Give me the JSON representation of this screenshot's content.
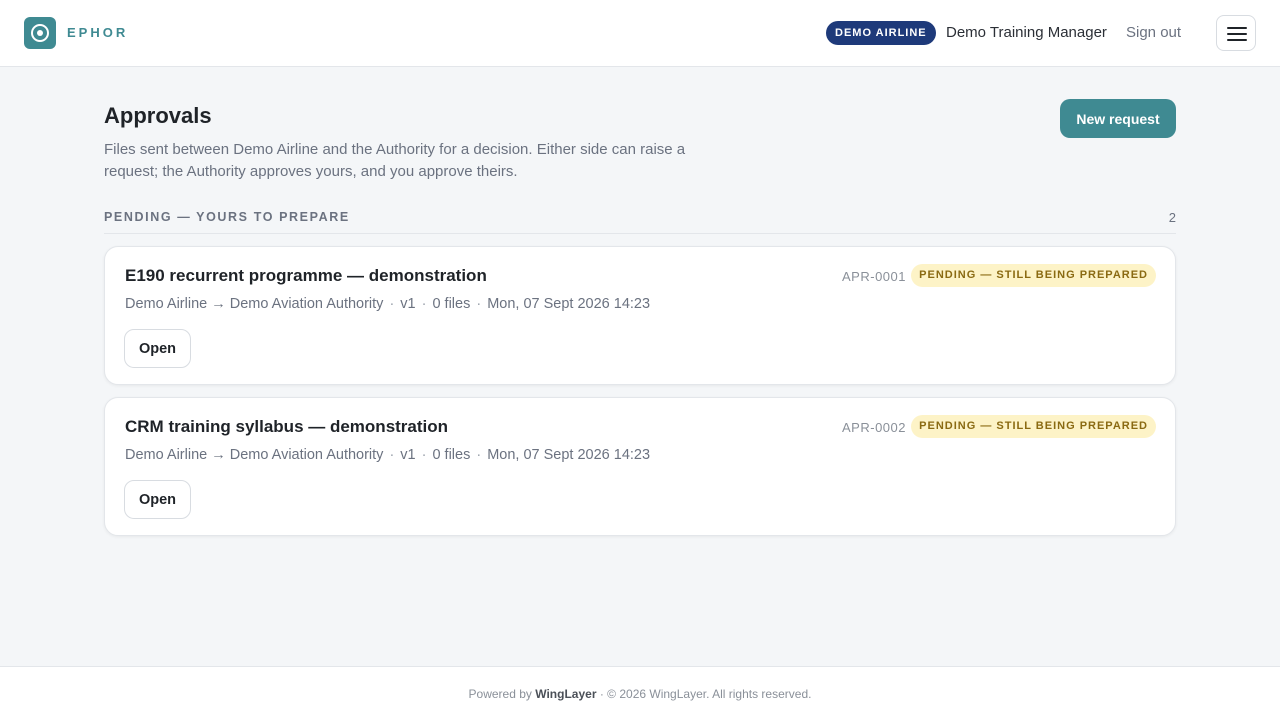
{
  "header": {
    "brand": "EPHOR",
    "org_badge": "DEMO AIRLINE",
    "user_name": "Demo Training Manager",
    "sign_out": "Sign out"
  },
  "page": {
    "title": "Approvals",
    "description": "Files sent between Demo Airline and the Authority for a decision. Either side can raise a request; the Authority approves yours, and you approve theirs.",
    "new_request_label": "New request"
  },
  "section": {
    "heading": "PENDING — YOURS TO PREPARE",
    "count": "2"
  },
  "requests": [
    {
      "title": "E190 recurrent programme — demonstration",
      "route": "Demo Airline → Demo Aviation Authority",
      "version": "v1",
      "files": "0 files",
      "timestamp": "Mon, 07 Sept 2026 14:23",
      "ref": "APR-0001",
      "status": "PENDING — STILL BEING PREPARED",
      "open_label": "Open"
    },
    {
      "title": "CRM training syllabus — demonstration",
      "route": "Demo Airline → Demo Aviation Authority",
      "version": "v1",
      "files": "0 files",
      "timestamp": "Mon, 07 Sept 2026 14:23",
      "ref": "APR-0002",
      "status": "PENDING — STILL BEING PREPARED",
      "open_label": "Open"
    }
  ],
  "meta_separator": "·",
  "footer": {
    "powered_by": "Powered by",
    "company": "WingLayer",
    "rights": "· © 2026 WingLayer. All rights reserved."
  },
  "colors": {
    "accent": "#3f8a92",
    "org_badge_bg": "#1e3a7a",
    "status_bg": "#fdf3c7",
    "status_text": "#8a6a12"
  },
  "icons": {
    "logo": "ephor-logo-icon",
    "menu": "hamburger-menu-icon"
  }
}
